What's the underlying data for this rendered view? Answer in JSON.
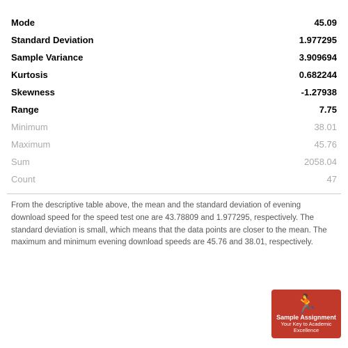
{
  "stats": {
    "rows": [
      {
        "label": "Mode",
        "value": "45.09",
        "type": "bold"
      },
      {
        "label": "Standard Deviation",
        "value": "1.977295",
        "type": "bold"
      },
      {
        "label": "Sample Variance",
        "value": "3.909694",
        "type": "bold"
      },
      {
        "label": "Kurtosis",
        "value": "0.682244",
        "type": "bold"
      },
      {
        "label": "Skewness",
        "value": "-1.27938",
        "type": "bold"
      },
      {
        "label": "Range",
        "value": "7.75",
        "type": "bold"
      },
      {
        "label": "Minimum",
        "value": "38.01",
        "type": "muted"
      },
      {
        "label": "Maximum",
        "value": "45.76",
        "type": "muted"
      },
      {
        "label": "Sum",
        "value": "2058.04",
        "type": "muted"
      },
      {
        "label": "Count",
        "value": "47",
        "type": "muted"
      }
    ],
    "description": "From the descriptive table above, the mean and the standard deviation of evening download speed for the speed test one are 43.78809 and 1.977295, respectively. The standard deviation is small, which means that the data points are closer to the mean. The maximum and minimum evening download speeds are 45.76 and 38.01, respectively."
  },
  "watermark": {
    "icon": "🏃",
    "title": "Sample Assignment",
    "subtitle": "Your Key to Academic Excellence"
  }
}
